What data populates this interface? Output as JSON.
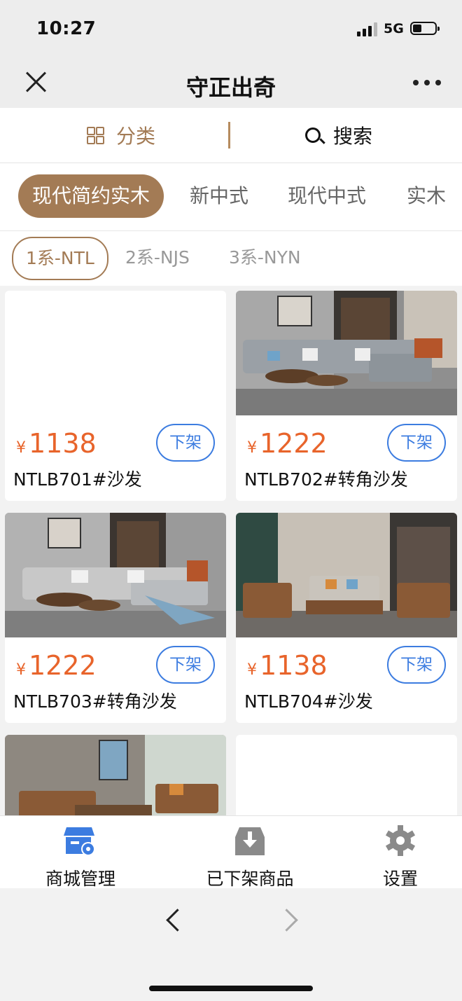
{
  "status_bar": {
    "time": "10:27",
    "network": "5G"
  },
  "nav": {
    "title": "守正出奇"
  },
  "toolbar": {
    "category_label": "分类",
    "search_label": "搜索"
  },
  "category_tabs": [
    {
      "label": "现代简约实木",
      "active": true
    },
    {
      "label": "新中式",
      "active": false
    },
    {
      "label": "现代中式",
      "active": false
    },
    {
      "label": "实木",
      "active": false
    }
  ],
  "series_tabs": [
    {
      "label": "1系-NTL",
      "active": true
    },
    {
      "label": "2系-NJS",
      "active": false
    },
    {
      "label": "3系-NYN",
      "active": false
    }
  ],
  "products": [
    {
      "currency": "¥",
      "price": "1138",
      "name": "NTLB701#沙发",
      "action": "下架"
    },
    {
      "currency": "¥",
      "price": "1222",
      "name": "NTLB702#转角沙发",
      "action": "下架"
    },
    {
      "currency": "¥",
      "price": "1222",
      "name": "NTLB703#转角沙发",
      "action": "下架"
    },
    {
      "currency": "¥",
      "price": "1138",
      "name": "NTLB704#沙发",
      "action": "下架"
    }
  ],
  "tabbar": [
    {
      "label": "商城管理",
      "icon": "shop-settings-icon",
      "color": "#3c7ce0"
    },
    {
      "label": "已下架商品",
      "icon": "download-box-icon",
      "color": "#8a8a8a"
    },
    {
      "label": "设置",
      "icon": "gear-icon",
      "color": "#8a8a8a"
    }
  ],
  "colors": {
    "accent": "#a37b55",
    "price": "#e8642b",
    "action": "#3c7ce0"
  }
}
